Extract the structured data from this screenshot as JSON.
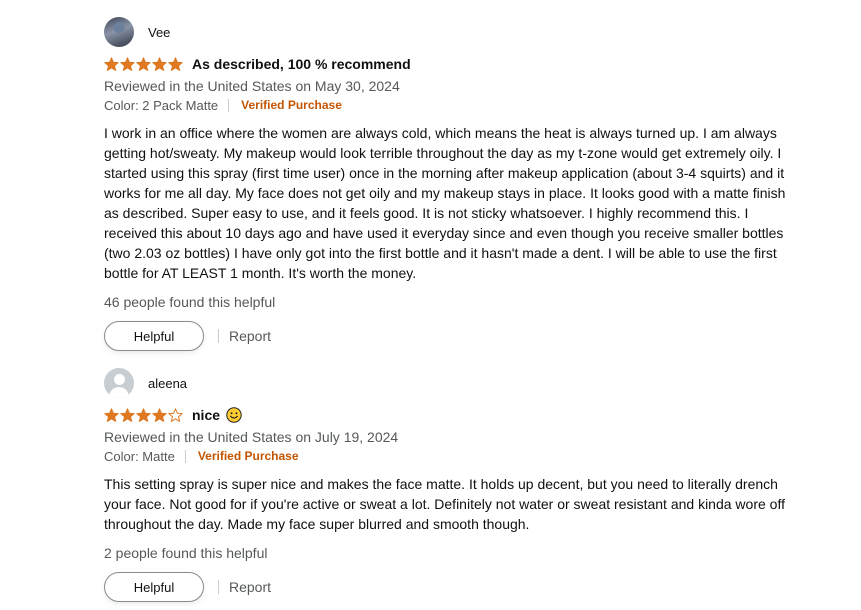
{
  "reviews": [
    {
      "reviewer": "Vee",
      "rating": 5,
      "title": "As described, 100 % recommend",
      "has_emoji": false,
      "date_line": "Reviewed in the United States on May 30, 2024",
      "variant": "Color: 2 Pack Matte",
      "verified": "Verified Purchase",
      "body": "I work in an office where the women are always cold, which means the heat is always turned up. I am always getting hot/sweaty. My makeup would look terrible throughout the day as my t-zone would get extremely oily. I started using this spray (first time user) once in the morning after makeup application (about 3-4 squirts) and it works for me all day. My face does not get oily and my makeup stays in place. It looks good with a matte finish as described. Super easy to use, and it feels good. It is not sticky whatsoever. I highly recommend this. I received this about 10 days ago and have used it everyday since and even though you receive smaller bottles (two 2.03 oz bottles) I have only got into the first bottle and it hasn't made a dent. I will be able to use the first bottle for AT LEAST 1 month. It's worth the money.",
      "helpful_count": "46 people found this helpful",
      "helpful_label": "Helpful",
      "report_label": "Report"
    },
    {
      "reviewer": "aleena",
      "rating": 4,
      "title": "nice",
      "has_emoji": true,
      "date_line": "Reviewed in the United States on July 19, 2024",
      "variant": "Color: Matte",
      "verified": "Verified Purchase",
      "body": "This setting spray is super nice and makes the face matte. It holds up decent, but you need to literally drench your face. Not good for if you're active or sweat a lot. Definitely not water or sweat resistant and kinda wore off throughout the day. Made my face super blurred and smooth though.",
      "helpful_count": "2 people found this helpful",
      "helpful_label": "Helpful",
      "report_label": "Report"
    }
  ],
  "colors": {
    "star_fill": "#de7921",
    "verified": "#c45500",
    "muted_text": "#565959"
  }
}
